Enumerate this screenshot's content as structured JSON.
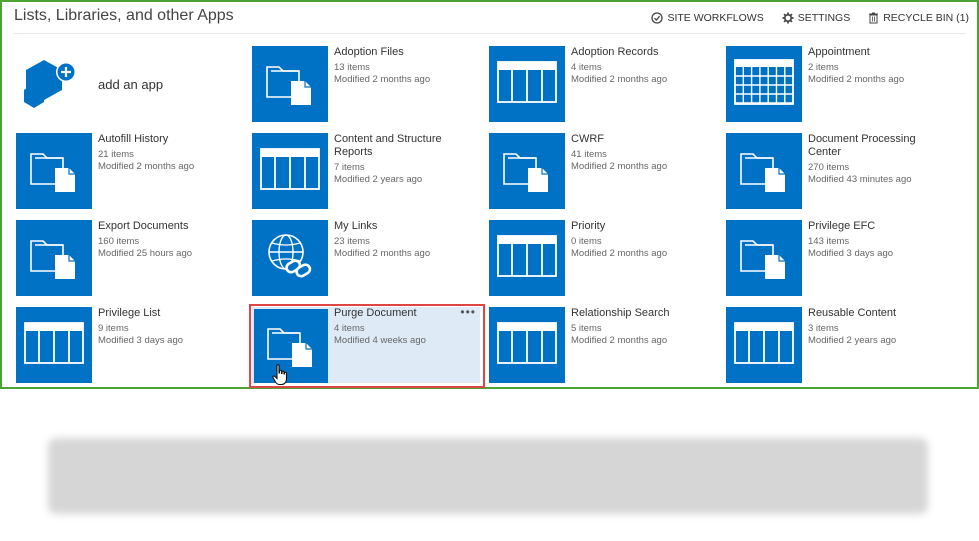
{
  "page": {
    "title": "Lists, Libraries, and other Apps"
  },
  "toolbar": {
    "site_workflows": "SITE WORKFLOWS",
    "settings": "SETTINGS",
    "recycle_bin": "RECYCLE BIN (1)"
  },
  "add_app": {
    "label": "add an app",
    "icon": "add-app-icon"
  },
  "tiles": [
    {
      "name": "Adoption Files",
      "count": "13 items",
      "modified": "Modified 2 months ago",
      "icon": "folder-document-icon"
    },
    {
      "name": "Adoption Records",
      "count": "4 items",
      "modified": "Modified 2 months ago",
      "icon": "list-icon"
    },
    {
      "name": "Appointment",
      "count": "2 items",
      "modified": "Modified 2 months ago",
      "icon": "calendar-icon"
    },
    {
      "name": "Autofill History",
      "count": "21 items",
      "modified": "Modified 2 months ago",
      "icon": "folder-document-icon"
    },
    {
      "name": "Content and Structure Reports",
      "count": "7 items",
      "modified": "Modified 2 years ago",
      "icon": "list-icon"
    },
    {
      "name": "CWRF",
      "count": "41 items",
      "modified": "Modified 2 months ago",
      "icon": "folder-document-icon"
    },
    {
      "name": "Document Processing Center",
      "count": "270 items",
      "modified": "Modified 43 minutes ago",
      "icon": "folder-document-icon"
    },
    {
      "name": "Export Documents",
      "count": "160 items",
      "modified": "Modified 25 hours ago",
      "icon": "folder-document-icon"
    },
    {
      "name": "My Links",
      "count": "23 items",
      "modified": "Modified 2 months ago",
      "icon": "globe-link-icon"
    },
    {
      "name": "Priority",
      "count": "0 items",
      "modified": "Modified 2 months ago",
      "icon": "list-icon"
    },
    {
      "name": "Privilege EFC",
      "count": "143 items",
      "modified": "Modified 3 days ago",
      "icon": "folder-document-icon"
    },
    {
      "name": "Privilege List",
      "count": "9 items",
      "modified": "Modified 3 days ago",
      "icon": "list-icon"
    },
    {
      "name": "Purge Document",
      "count": "4 items",
      "modified": "Modified 4 weeks ago",
      "icon": "folder-document-icon",
      "selected": true,
      "menu": "•••"
    },
    {
      "name": "Relationship Search",
      "count": "5 items",
      "modified": "Modified 2 months ago",
      "icon": "list-icon"
    },
    {
      "name": "Reusable Content",
      "count": "3 items",
      "modified": "Modified 2 years ago",
      "icon": "list-icon"
    }
  ],
  "colors": {
    "tile_blue": "#0072c6",
    "frame_green": "#4aa333",
    "selection_red": "#e04545",
    "selection_bg": "#deeaf5"
  }
}
